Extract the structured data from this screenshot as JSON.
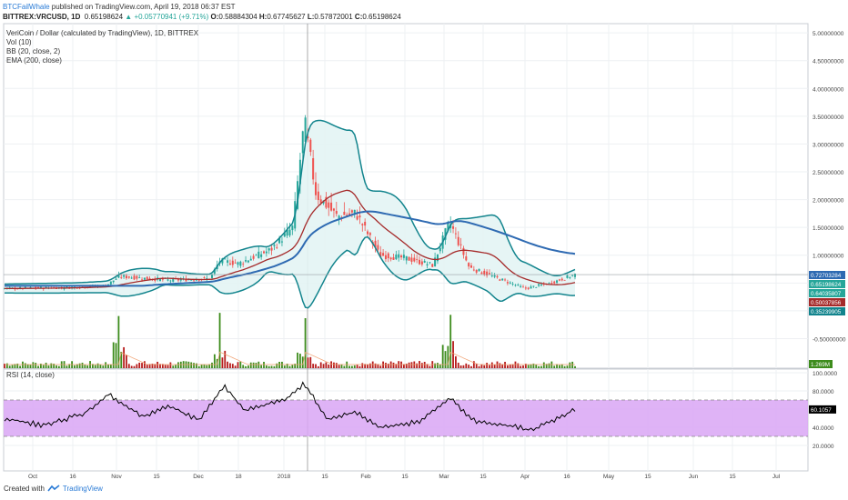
{
  "header": {
    "author": "BTCFailWhale",
    "published_text": " published on TradingView.com, April 19, 2018 06:37 EST",
    "symbol": "BITTREX:VRCUSD, 1D",
    "last": "0.65198624",
    "change": "▲ +0.05770941 (+9.71%)",
    "o_label": "O:",
    "o": "0.58884304",
    "h_label": "H:",
    "h": "0.67745627",
    "l_label": "L:",
    "l": "0.57872001",
    "c_label": "C:",
    "c": "0.65198624"
  },
  "legend": {
    "line1": "VeriCoin / Dollar (calculated by TradingView), 1D, BITTREX",
    "line2": "Vol (10)",
    "line3": "BB (20, close, 2)",
    "line4": "EMA (200, close)"
  },
  "rsi_label": "RSI (14, close)",
  "footer": {
    "created_with": "Created with",
    "brand": "TradingView"
  },
  "colors": {
    "up": "#26a69a",
    "down": "#ef5350",
    "bb": "#12848d",
    "bb_fill": "#e3f4f4",
    "ema": "#2e6ab2",
    "basis": "#a52a2a",
    "rsi_band": "#d9a6f5",
    "rsi_line": "#000000",
    "vol_up": "#3d8c1c",
    "vol_down": "#b71c1c",
    "vol_ma": "#f0a070"
  },
  "chart_data": [
    {
      "type": "candlestick",
      "title": "VeriCoin / Dollar (calculated by TradingView), 1D, BITTREX",
      "x_ticks": [
        "Oct",
        "16",
        "Nov",
        "15",
        "Dec",
        "18",
        "2018",
        "15",
        "Feb",
        "15",
        "Mar",
        "15",
        "Apr",
        "16",
        "May",
        "15",
        "Jun",
        "15",
        "Jul"
      ],
      "y_ticks": [
        "5.00000000",
        "4.50000000",
        "4.00000000",
        "3.50000000",
        "3.00000000",
        "2.50000000",
        "2.00000000",
        "1.50000000",
        "1.00000000",
        "0.50000000",
        "0.00000000",
        "-0.50000000"
      ],
      "ylim": [
        -0.95,
        5.1
      ],
      "price_points": [
        {
          "x": "Sep 21",
          "y": 0.4
        },
        {
          "x": "Oct 15",
          "y": 0.42
        },
        {
          "x": "Oct 28",
          "y": 0.45
        },
        {
          "x": "Nov 2",
          "y": 0.62
        },
        {
          "x": "Nov 20",
          "y": 0.55
        },
        {
          "x": "Dec 6",
          "y": 0.58
        },
        {
          "x": "Dec 10",
          "y": 0.9
        },
        {
          "x": "Dec 18",
          "y": 0.85
        },
        {
          "x": "Dec 28",
          "y": 1.1
        },
        {
          "x": "Jan 4",
          "y": 1.5
        },
        {
          "x": "Jan 8",
          "y": 3.4
        },
        {
          "x": "Jan 12",
          "y": 2.1
        },
        {
          "x": "Jan 20",
          "y": 1.7
        },
        {
          "x": "Jan 28",
          "y": 1.75
        },
        {
          "x": "Feb 6",
          "y": 1.0
        },
        {
          "x": "Feb 15",
          "y": 0.95
        },
        {
          "x": "Feb 25",
          "y": 0.82
        },
        {
          "x": "Mar 3",
          "y": 1.6
        },
        {
          "x": "Mar 10",
          "y": 0.78
        },
        {
          "x": "Mar 20",
          "y": 0.6
        },
        {
          "x": "Apr 1",
          "y": 0.4
        },
        {
          "x": "Apr 10",
          "y": 0.5
        },
        {
          "x": "Apr 19",
          "y": 0.652
        }
      ],
      "last_labels": [
        "0.72703284",
        "0.65198624",
        "0.64035807",
        "0.50037856",
        "0.35239905"
      ],
      "volume_last_label": "1.269M",
      "volume_spikes": [
        {
          "x": "Nov 2",
          "value": "large"
        },
        {
          "x": "Dec 10",
          "value": "large"
        },
        {
          "x": "Jan 8",
          "value": "large"
        },
        {
          "x": "Mar 3",
          "value": "large"
        }
      ]
    },
    {
      "type": "line",
      "title": "RSI (14, close)",
      "y_ticks": [
        "100.0000",
        "80.0000",
        "60.0000",
        "40.0000",
        "20.0000"
      ],
      "ylim": [
        0,
        100
      ],
      "band": [
        30,
        70
      ],
      "last_label": "60.1057",
      "points": [
        {
          "x": "Sep 21",
          "y": 50
        },
        {
          "x": "Oct 5",
          "y": 42
        },
        {
          "x": "Oct 20",
          "y": 55
        },
        {
          "x": "Oct 29",
          "y": 76
        },
        {
          "x": "Nov 10",
          "y": 52
        },
        {
          "x": "Nov 20",
          "y": 63
        },
        {
          "x": "Dec 1",
          "y": 48
        },
        {
          "x": "Dec 12",
          "y": 86
        },
        {
          "x": "Dec 20",
          "y": 58
        },
        {
          "x": "Jan 2",
          "y": 72
        },
        {
          "x": "Jan 8",
          "y": 88
        },
        {
          "x": "Jan 16",
          "y": 48
        },
        {
          "x": "Jan 28",
          "y": 57
        },
        {
          "x": "Feb 6",
          "y": 40
        },
        {
          "x": "Feb 20",
          "y": 46
        },
        {
          "x": "Mar 3",
          "y": 72
        },
        {
          "x": "Mar 12",
          "y": 47
        },
        {
          "x": "Mar 25",
          "y": 42
        },
        {
          "x": "Apr 3",
          "y": 37
        },
        {
          "x": "Apr 12",
          "y": 48
        },
        {
          "x": "Apr 19",
          "y": 60.1
        }
      ]
    }
  ]
}
